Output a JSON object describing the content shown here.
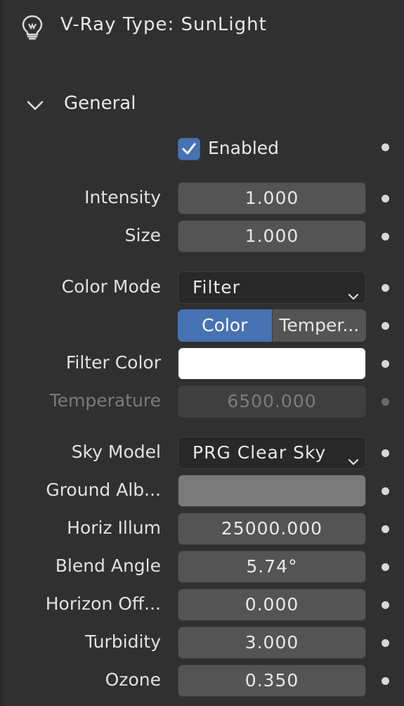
{
  "header": {
    "label": "V-Ray Type:  SunLight",
    "icon": "lightbulb-icon"
  },
  "section": {
    "title": "General",
    "expanded": true
  },
  "enabled": {
    "label": "Enabled",
    "checked": true
  },
  "properties": {
    "intensity": {
      "label": "Intensity",
      "value": "1.000"
    },
    "size": {
      "label": "Size",
      "value": "1.000"
    },
    "color_mode": {
      "label": "Color Mode",
      "value": "Filter"
    },
    "color_mode_toggle": {
      "option_color": "Color",
      "option_temperature": "Temper..."
    },
    "filter_color": {
      "label": "Filter Color",
      "color": "#ffffff"
    },
    "temperature": {
      "label": "Temperature",
      "value": "6500.000"
    },
    "sky_model": {
      "label": "Sky Model",
      "value": "PRG Clear Sky"
    },
    "ground_albedo": {
      "label": "Ground Alb...",
      "color": "#7a7a7a"
    },
    "horiz_illum": {
      "label": "Horiz Illum",
      "value": "25000.000"
    },
    "blend_angle": {
      "label": "Blend Angle",
      "value": "5.74°"
    },
    "horizon_offset": {
      "label": "Horizon Off...",
      "value": "0.000"
    },
    "turbidity": {
      "label": "Turbidity",
      "value": "3.000"
    },
    "ozone": {
      "label": "Ozone",
      "value": "0.350"
    }
  },
  "colors": {
    "panel_bg": "#303030",
    "field_bg": "#545454",
    "accent": "#4772b3"
  }
}
